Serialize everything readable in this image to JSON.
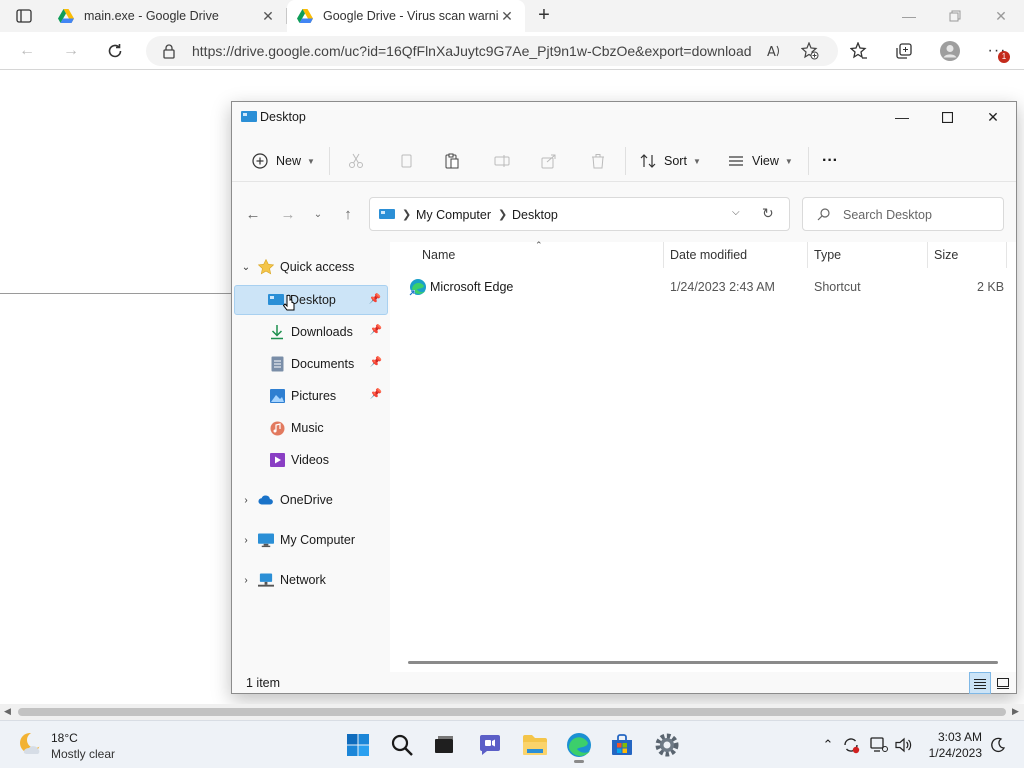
{
  "browser": {
    "tabs": [
      {
        "title": "main.exe - Google Drive",
        "active": false
      },
      {
        "title": "Google Drive - Virus scan warnin",
        "active": true
      }
    ],
    "new_tab": "+",
    "url": "https://drive.google.com/uc?id=16QfFlnXaJuytc9G7Ae_Pjt9n1w-CbzOe&export=download",
    "notification_badge": "1"
  },
  "explorer": {
    "title": "Desktop",
    "commands": {
      "new": "New",
      "sort": "Sort",
      "view": "View",
      "more": "···"
    },
    "breadcrumb": [
      "My Computer",
      "Desktop"
    ],
    "search_placeholder": "Search Desktop",
    "sidebar": {
      "quick_access": "Quick access",
      "items": [
        "Desktop",
        "Downloads",
        "Documents",
        "Pictures",
        "Music",
        "Videos"
      ],
      "onedrive": "OneDrive",
      "my_computer": "My Computer",
      "network": "Network"
    },
    "columns": {
      "name": "Name",
      "date": "Date modified",
      "type": "Type",
      "size": "Size"
    },
    "files": [
      {
        "name": "Microsoft Edge",
        "date": "1/24/2023 2:43 AM",
        "type": "Shortcut",
        "size": "2 KB"
      }
    ],
    "status": "1 item"
  },
  "taskbar": {
    "weather_temp": "18°C",
    "weather_cond": "Mostly clear",
    "time": "3:03 AM",
    "date": "1/24/2023"
  },
  "colors": {
    "accent": "#0067c0",
    "selection": "#cce4f7",
    "folder_yellow": "#f4c54a"
  }
}
